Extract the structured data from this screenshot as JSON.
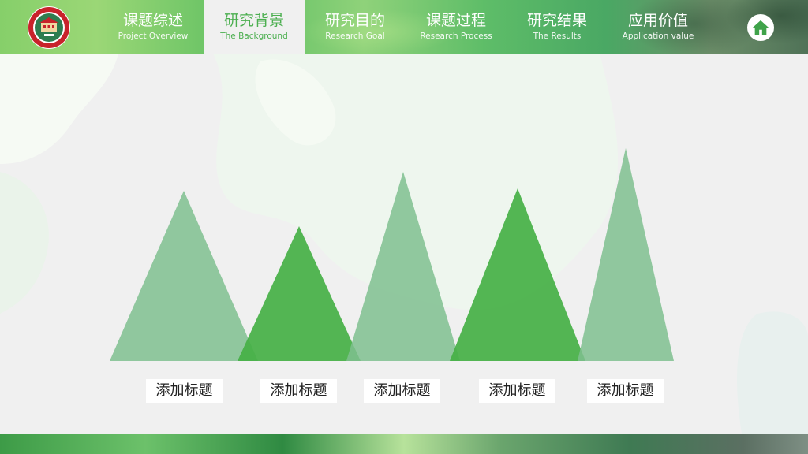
{
  "nav": {
    "items": [
      {
        "zh": "课题综述",
        "en": "Project Overview"
      },
      {
        "zh": "研究背景",
        "en": "The Background"
      },
      {
        "zh": "研究目的",
        "en": "Research Goal"
      },
      {
        "zh": "课题过程",
        "en": "Research Process"
      },
      {
        "zh": "研究结果",
        "en": "The Results"
      },
      {
        "zh": "应用价值",
        "en": "Application value"
      }
    ],
    "active_index": 1
  },
  "icons": {
    "logo": "university-seal-icon",
    "home": "home-icon"
  },
  "colors": {
    "accent": "#4caf50",
    "triangle_light": "#7fc08f",
    "triangle_dark": "#45b045",
    "background": "#f0f0f0"
  },
  "chart_data": {
    "type": "bar",
    "categories": [
      "添加标题",
      "添加标题",
      "添加标题",
      "添加标题",
      "添加标题"
    ],
    "values": [
      72,
      57,
      80,
      73,
      90
    ]
  }
}
